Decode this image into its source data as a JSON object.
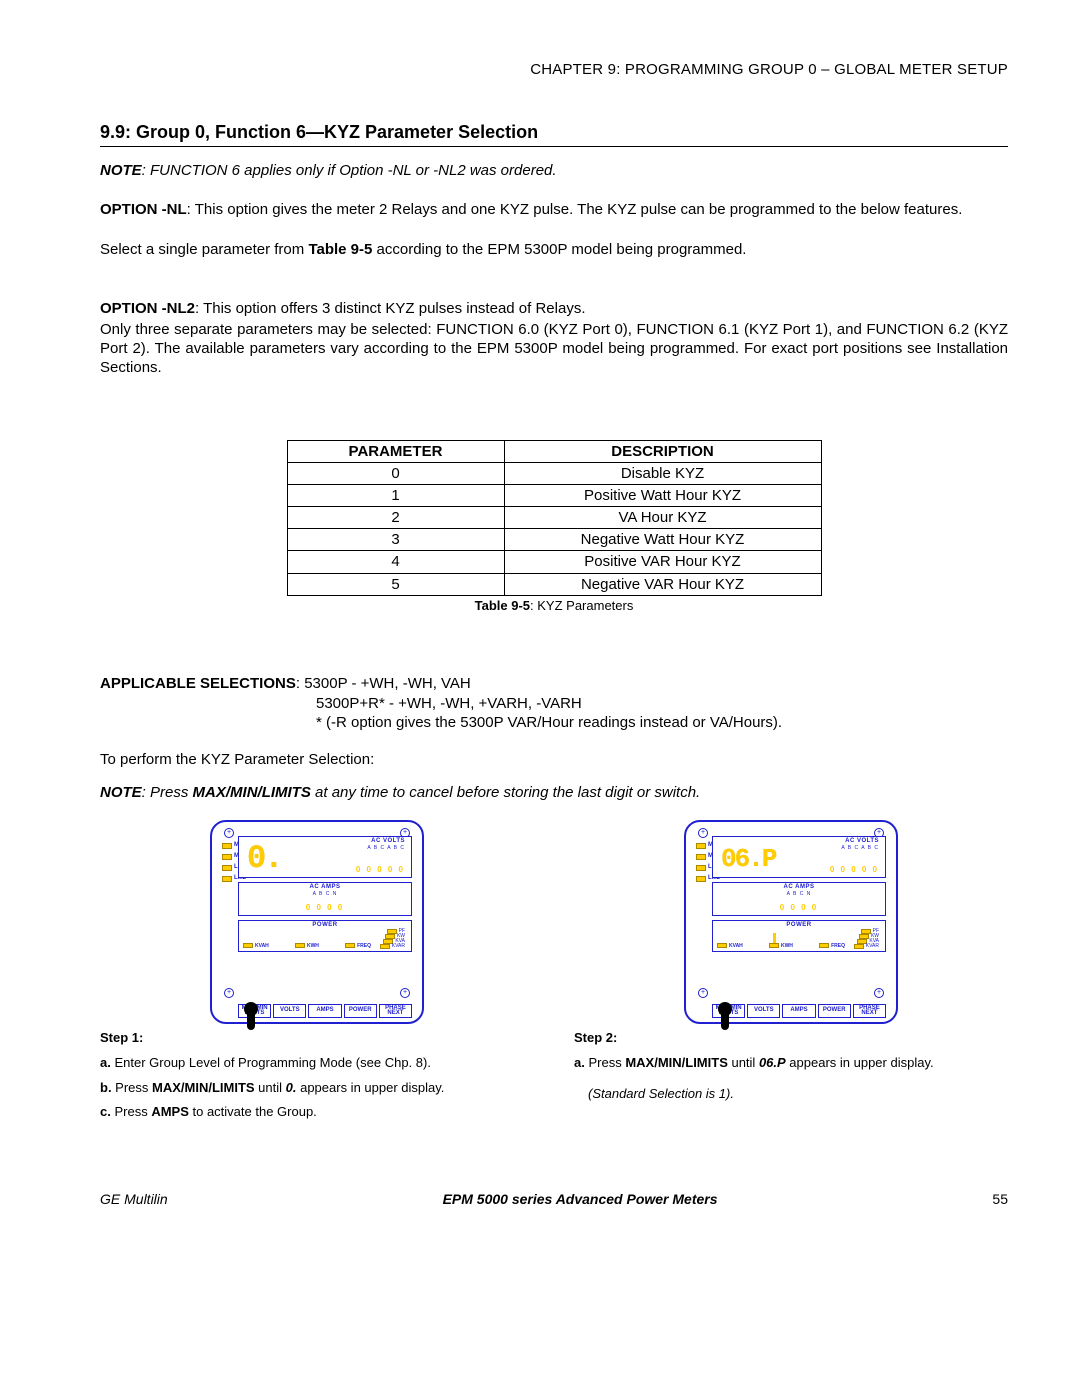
{
  "chapter_header": "CHAPTER 9: PROGRAMMING GROUP 0 – GLOBAL METER SETUP",
  "section_title": "9.9: Group 0, Function 6—KYZ Parameter Selection",
  "note1_label": "NOTE",
  "note1_text": ": FUNCTION 6 applies only if Option -NL or -NL2 was ordered.",
  "option_nl_label": "OPTION -NL",
  "option_nl_text": ": This option gives the meter 2 Relays and one KYZ pulse.  The KYZ pulse can be programmed to the below features.",
  "select_text_1": "Select a single parameter from ",
  "select_text_bold": "Table 9-5",
  "select_text_2": " according to the EPM 5300P model being programmed.",
  "option_nl2_label": "OPTION -NL2",
  "option_nl2_text": ": This option offers 3 distinct KYZ pulses instead of Relays.",
  "nl2_para": "Only three separate parameters may be selected:  FUNCTION 6.0 (KYZ Port 0), FUNCTION 6.1 (KYZ Port 1), and FUNCTION 6.2 (KYZ Port 2). The available parameters vary according to the EPM 5300P model being programmed. For exact port positions see Installation Sections.",
  "table": {
    "headers": [
      "PARAMETER",
      "DESCRIPTION"
    ],
    "rows": [
      [
        "0",
        "Disable KYZ"
      ],
      [
        "1",
        "Positive Watt Hour KYZ"
      ],
      [
        "2",
        "VA Hour KYZ"
      ],
      [
        "3",
        "Negative Watt Hour KYZ"
      ],
      [
        "4",
        "Positive VAR Hour KYZ"
      ],
      [
        "5",
        "Negative VAR Hour KYZ"
      ]
    ],
    "caption_bold": "Table 9-5",
    "caption_rest": ": KYZ Parameters"
  },
  "applicable_label": "APPLICABLE SELECTIONS",
  "applicable_text": ":  5300P - +WH, -WH, VAH",
  "applicable_line2": "5300P+R* - +WH, -WH, +VARH, -VARH",
  "applicable_line3": "* (-R option gives the 5300P VAR/Hour readings instead or VA/Hours).",
  "perform_text": "To perform the KYZ Parameter Selection:",
  "note2_label": "NOTE",
  "note2_text_1": ":  Press ",
  "note2_bold": "MAX/MIN/LIMITS",
  "note2_text_2": " at any time to cancel before storing the last digit or switch.",
  "meter": {
    "leds_left": [
      "MAX",
      "MIN",
      "LM1",
      "LM2"
    ],
    "lcd1_title": "AC VOLTS",
    "lcd1_sub": "A  B  C   A  B  C",
    "lcd1_digits": "0 0 0 0 0",
    "display1_seg": "0.",
    "display2_seg": "06.P",
    "lcd2_title": "AC AMPS",
    "lcd2_sub": "A  B  C  N",
    "lcd2_digits": "0 0 0 0",
    "lcd3_title": "POWER",
    "lcd3_r": [
      "PF",
      "KW",
      "KVA",
      "KVAR"
    ],
    "lcd3_bottom": [
      "KVAH",
      "KWH",
      "FREQ"
    ],
    "buttons": [
      "MAX MIN\nLIMITS",
      "VOLTS",
      "AMPS",
      "POWER",
      "PHASE\nNEXT"
    ]
  },
  "step1": {
    "title": "Step 1:",
    "a": "Enter Group Level of Programming Mode (see Chp. 8).",
    "b_pre": "Press ",
    "b_bold": "MAX/MIN/LIMITS",
    "b_post": " until ",
    "b_val": "0.",
    "b_end": " appears in upper display.",
    "c_pre": "Press ",
    "c_bold": "AMPS",
    "c_post": " to activate the Group."
  },
  "step2": {
    "title": "Step 2:",
    "a_pre": "Press ",
    "a_bold": "MAX/MIN/LIMITS",
    "a_post": " until ",
    "a_val": "06.P",
    "a_end": " appears in upper display.",
    "note": "(Standard Selection is 1)."
  },
  "footer": {
    "left": "GE Multilin",
    "center": "EPM 5000 series Advanced Power Meters",
    "right": "55"
  }
}
